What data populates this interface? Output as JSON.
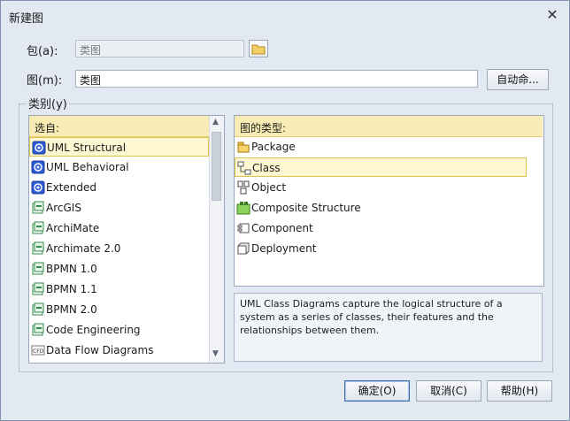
{
  "dialog": {
    "title": "新建图",
    "close_glyph": "✕"
  },
  "package": {
    "label": "包(a):",
    "value": "类图"
  },
  "diagram": {
    "label": "图(m):",
    "value": "类图",
    "auto_button": "自动命..."
  },
  "category": {
    "label": "类别(y)"
  },
  "source": {
    "header": "选自:",
    "items": [
      {
        "label": "UML Structural",
        "icon": "uml-icon",
        "selected": true
      },
      {
        "label": "UML Behavioral",
        "icon": "uml-icon",
        "selected": false
      },
      {
        "label": "Extended",
        "icon": "uml-icon",
        "selected": false
      },
      {
        "label": "ArcGIS",
        "icon": "technology-icon",
        "selected": false
      },
      {
        "label": "ArchiMate",
        "icon": "technology-icon",
        "selected": false
      },
      {
        "label": "Archimate 2.0",
        "icon": "technology-icon",
        "selected": false
      },
      {
        "label": "BPMN 1.0",
        "icon": "technology-icon",
        "selected": false
      },
      {
        "label": "BPMN 1.1",
        "icon": "technology-icon",
        "selected": false
      },
      {
        "label": "BPMN 2.0",
        "icon": "technology-icon",
        "selected": false
      },
      {
        "label": "Code Engineering",
        "icon": "technology-icon",
        "selected": false
      },
      {
        "label": "Data Flow Diagrams",
        "icon": "dfd-icon",
        "selected": false
      }
    ]
  },
  "types": {
    "header": "图的类型:",
    "items": [
      {
        "label": "Package",
        "icon": "package-icon",
        "selected": false
      },
      {
        "label": "Class",
        "icon": "class-icon",
        "selected": true
      },
      {
        "label": "Object",
        "icon": "object-icon",
        "selected": false
      },
      {
        "label": "Composite Structure",
        "icon": "composite-icon",
        "selected": false
      },
      {
        "label": "Component",
        "icon": "component-icon",
        "selected": false
      },
      {
        "label": "Deployment",
        "icon": "deployment-icon",
        "selected": false
      }
    ]
  },
  "description": "UML Class Diagrams capture the logical structure of a system as a series of classes, their features and the relationships between them.",
  "buttons": {
    "ok": "确定(O)",
    "cancel": "取消(C)",
    "help": "帮助(H)"
  },
  "colors": {
    "header_bg": "#f8ecb4",
    "selection_bg": "#fff7d2",
    "dialog_bg": "#e3e9f2"
  }
}
